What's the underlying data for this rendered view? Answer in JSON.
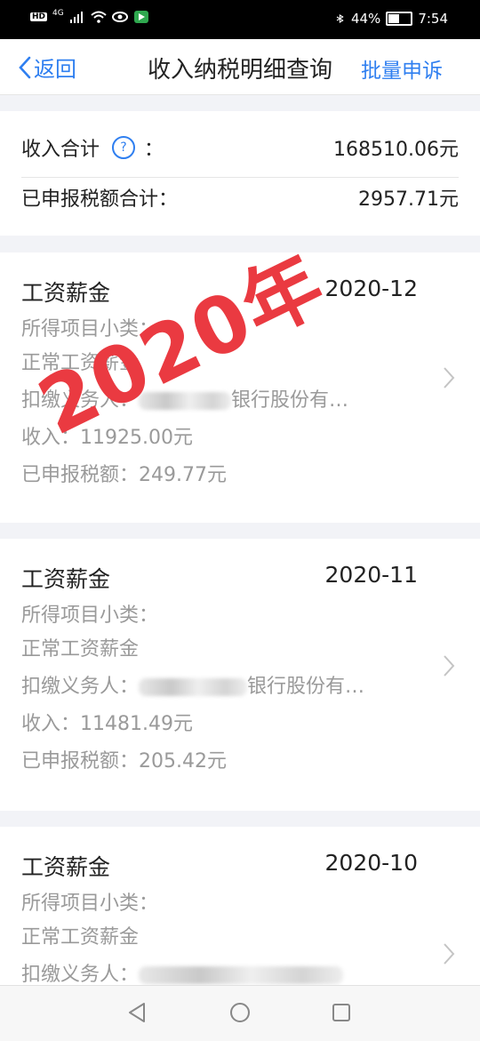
{
  "status_bar": {
    "hd": "HD",
    "network": "4G",
    "battery_text": "44%",
    "battery_level": 0.44,
    "time": "7:54"
  },
  "nav": {
    "back_label": "返回",
    "title": "收入纳税明细查询",
    "right_action": "批量申诉"
  },
  "summary": {
    "income_total_label": "收入合计",
    "help_icon": "?",
    "colon": "：",
    "income_total_value": "168510.06元",
    "tax_total_label": "已申报税额合计：",
    "tax_total_value": "2957.71元"
  },
  "watermark": "2020年",
  "records": [
    {
      "category": "工资薪金",
      "date": "2020-12",
      "sub_label": "所得项目小类：",
      "sub_value": "正常工资薪金",
      "payer_label": "扣缴义务人：",
      "payer_suffix": "银行股份有…",
      "income": "收入：11925.00元",
      "tax": "已申报税额：249.77元"
    },
    {
      "category": "工资薪金",
      "date": "2020-11",
      "sub_label": "所得项目小类：",
      "sub_value": "正常工资薪金",
      "payer_label": "扣缴义务人：",
      "payer_suffix": "银行股份有…",
      "income": "收入：11481.49元",
      "tax": "已申报税额：205.42元"
    },
    {
      "category": "工资薪金",
      "date": "2020-10",
      "sub_label": "所得项目小类：",
      "sub_value": "正常工资薪金",
      "payer_label": "扣缴义务人：",
      "payer_suffix": "",
      "income": "",
      "tax": ""
    }
  ],
  "icons": {
    "back": "chevron-left-icon",
    "help": "question-circle-icon",
    "record_arrow": "chevron-right-icon",
    "nav_back": "triangle-back-icon",
    "nav_home": "circle-home-icon",
    "nav_recent": "square-recent-icon"
  },
  "colors": {
    "accent": "#2f7ff0",
    "watermark": "#ea3a41",
    "muted_text": "#9a9a9a"
  }
}
